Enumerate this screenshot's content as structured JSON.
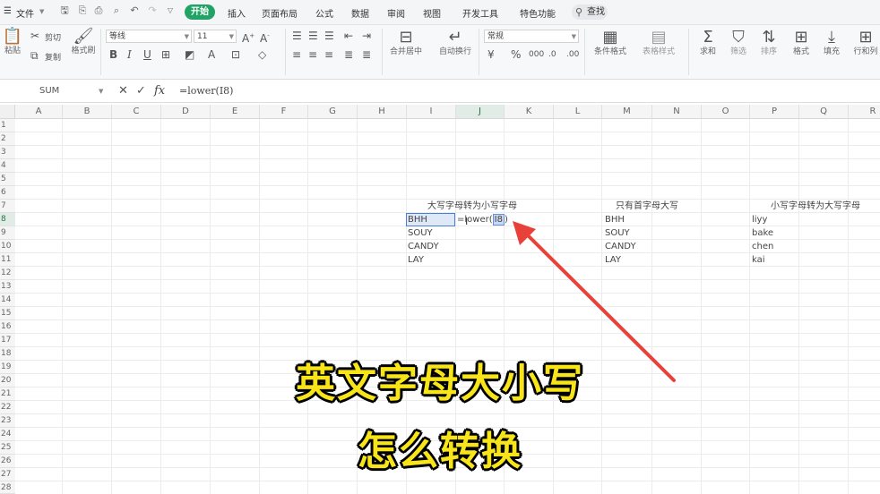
{
  "menubar": {
    "file_label": "文件",
    "tabs": [
      "开始",
      "插入",
      "页面布局",
      "公式",
      "数据",
      "审阅",
      "视图",
      "开发工具",
      "特色功能"
    ],
    "active_tab": "开始",
    "search_label": "查找"
  },
  "ribbon": {
    "paste": "粘贴",
    "cut": "剪切",
    "copy": "复制",
    "format_painter": "格式刷",
    "font_name": "等线",
    "font_size": "11",
    "merge_center": "合并居中",
    "wrap_text": "自动换行",
    "number_format": "常规",
    "conditional_format": "条件格式",
    "table_style": "表格样式",
    "sum": "求和",
    "filter": "筛选",
    "sort": "排序",
    "format": "格式",
    "fill": "填充",
    "row_col": "行和列"
  },
  "formula_bar": {
    "name_box": "SUM",
    "formula": "=lower(I8)",
    "fx": "fx"
  },
  "grid": {
    "columns": [
      "A",
      "B",
      "C",
      "D",
      "E",
      "F",
      "G",
      "H",
      "I",
      "J",
      "K",
      "L",
      "M",
      "N",
      "O",
      "P",
      "Q",
      "R"
    ],
    "selected_column": "J",
    "rows": [
      "1",
      "2",
      "3",
      "4",
      "5",
      "6",
      "7",
      "8",
      "9",
      "10",
      "11",
      "12",
      "13",
      "14",
      "15",
      "16",
      "17",
      "18",
      "19",
      "20",
      "21",
      "22",
      "23",
      "24",
      "25",
      "26",
      "27",
      "28"
    ],
    "selected_row": "8"
  },
  "sheet": {
    "header_i": "大写字母转为小写字母",
    "header_m": "只有首字母大写",
    "header_p": "小写字母转为大写字母",
    "col_i": [
      "BHH",
      "SOUY",
      "CANDY",
      "LAY"
    ],
    "col_m": [
      "BHH",
      "SOUY",
      "CANDY",
      "LAY"
    ],
    "col_p": [
      "liyy",
      "bake",
      "chen",
      "kai"
    ],
    "formula_prefix": "=lower(",
    "formula_ref": "I8",
    "formula_suffix": ")"
  },
  "caption": {
    "line1": "英文字母大小写",
    "line2": "怎么转换"
  },
  "colors": {
    "accent": "#21a366",
    "arrow": "#e8413a",
    "caption": "#f7e51a"
  }
}
